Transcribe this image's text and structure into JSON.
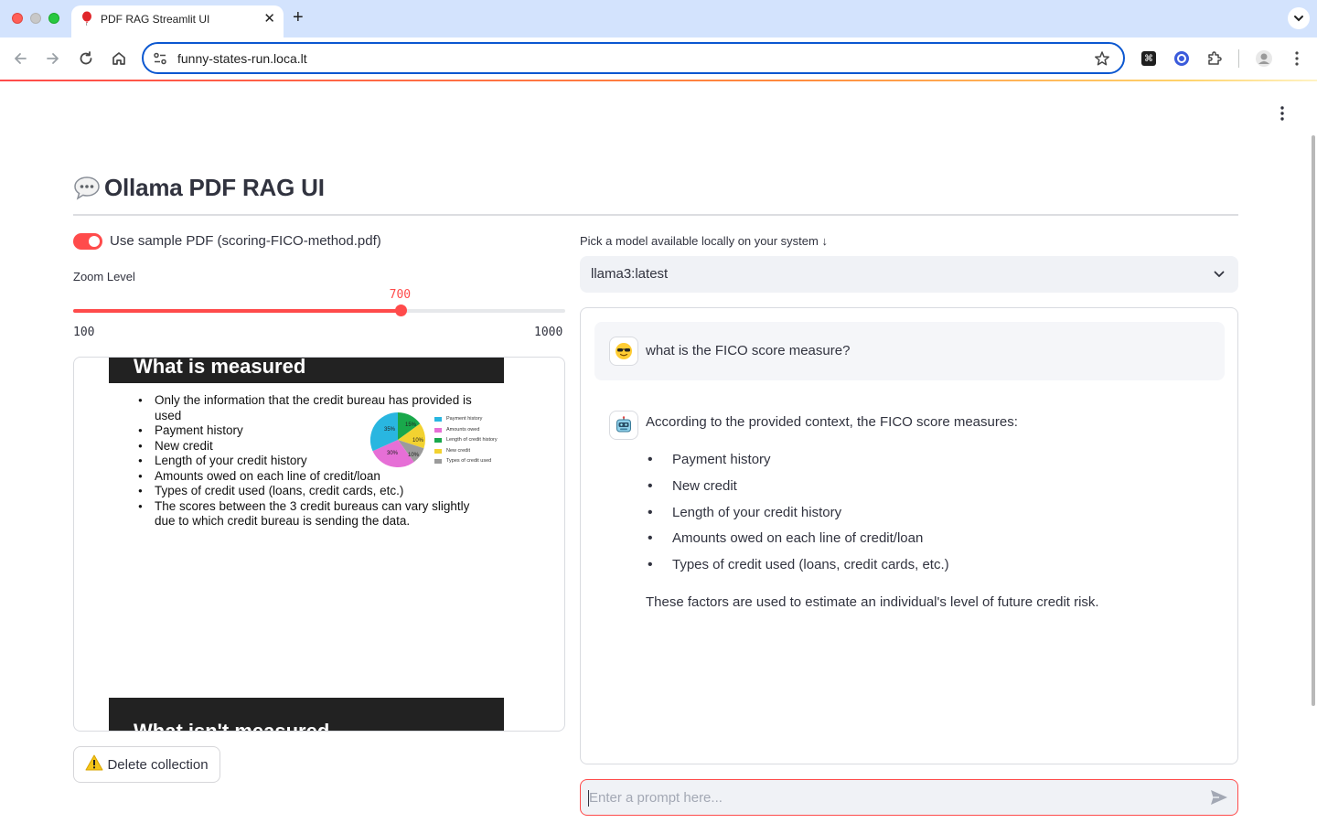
{
  "browser": {
    "tab_title": "PDF RAG Streamlit UI",
    "tab_favicon": "balloon-icon",
    "url": "funny-states-run.loca.lt"
  },
  "app": {
    "title": "Ollama PDF RAG UI",
    "title_icon": "speech-bubble-icon",
    "accent_color": "#ff4b4b"
  },
  "left": {
    "toggle_label": "Use sample PDF (scoring-FICO-method.pdf)",
    "toggle_on": true,
    "zoom_label": "Zoom Level",
    "zoom_value": "700",
    "zoom_min": "100",
    "zoom_max": "1000",
    "pdf": {
      "slide_title": "What is measured",
      "bullets": [
        "Only the information that the credit bureau has provided is used",
        "Payment history",
        "New credit",
        "Length of your credit history",
        "Amounts owed on each line of credit/loan",
        "Types of credit used (loans, credit cards, etc.)",
        "The scores between the 3 credit bureaus can vary slightly due to which credit bureau is sending the data."
      ],
      "pie_labels": [
        "35%",
        "15%",
        "10%",
        "30%",
        "10%"
      ],
      "legend": [
        "Payment history",
        "Amounts owed",
        "Length of credit history",
        "New credit",
        "Types of credit used"
      ],
      "next_slide_title": "What isn't measured"
    },
    "delete_button": "Delete collection"
  },
  "right": {
    "model_label": "Pick a model available locally on your system ↓",
    "model_value": "llama3:latest",
    "chat": {
      "user_message": "what is the FICO score measure?",
      "user_avatar": "sunglasses-face-icon",
      "bot_avatar": "robot-face-icon",
      "bot_intro": "According to the provided context, the FICO score measures:",
      "bot_items": [
        "Payment history",
        "New credit",
        "Length of your credit history",
        "Amounts owed on each line of credit/loan",
        "Types of credit used (loans, credit cards, etc.)"
      ],
      "bot_outro": "These factors are used to estimate an individual's level of future credit risk."
    },
    "prompt_placeholder": "Enter a prompt here..."
  }
}
